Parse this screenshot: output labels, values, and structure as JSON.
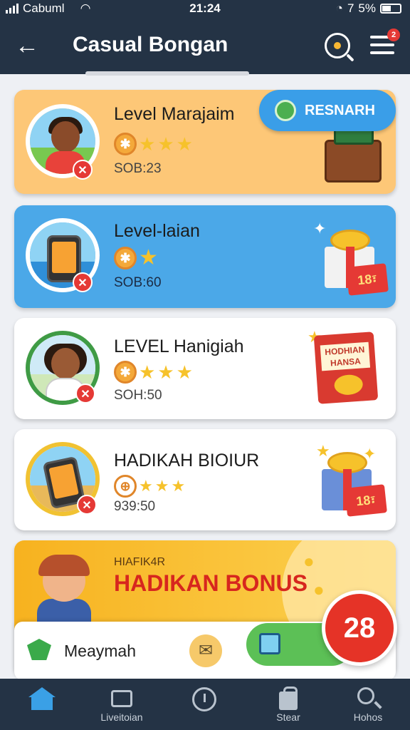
{
  "status_bar": {
    "carrier": "Cabuml",
    "time": "21:24",
    "battery_text": "5%",
    "extra": "7"
  },
  "header": {
    "title": "Casual Bongan",
    "menu_badge": "2"
  },
  "cards": [
    {
      "name": "Level Marajaim",
      "score": "SOB:23",
      "stars": 3,
      "bg": "#fdc777"
    },
    {
      "name": "Level-laian",
      "score": "SOB:60",
      "stars": 1,
      "bg": "#4ba8e8"
    },
    {
      "name": "LEVEL Hanigiah",
      "score": "SOH:50",
      "stars": 3,
      "bg": "#ffffff"
    },
    {
      "name": "HADIKAH BIOIUR",
      "score": "939:50",
      "stars": 3,
      "bg": "#ffffff"
    }
  ],
  "resnarh_button": {
    "label": "RESNARH"
  },
  "tags": {
    "card2": "18፣",
    "card4": "18፣"
  },
  "book_text": "HODHIAN HANSA",
  "bonus": {
    "eyebrow": "HIAFIK4R",
    "title": "HADIKAN BONUS"
  },
  "message": {
    "label": "Meaymah",
    "count": "28"
  },
  "nav": [
    {
      "label": "",
      "icon": "home-icon",
      "active": true
    },
    {
      "label": "Liveitoian",
      "icon": "keyboard-icon"
    },
    {
      "label": "",
      "icon": "clock-icon"
    },
    {
      "label": "Stear",
      "icon": "bag-icon"
    },
    {
      "label": "Hohos",
      "icon": "search-icon"
    }
  ],
  "colors": {
    "header": "#243345",
    "accent_red": "#e53935",
    "accent_blue": "#3a9ee8",
    "gold": "#f6c22b"
  }
}
